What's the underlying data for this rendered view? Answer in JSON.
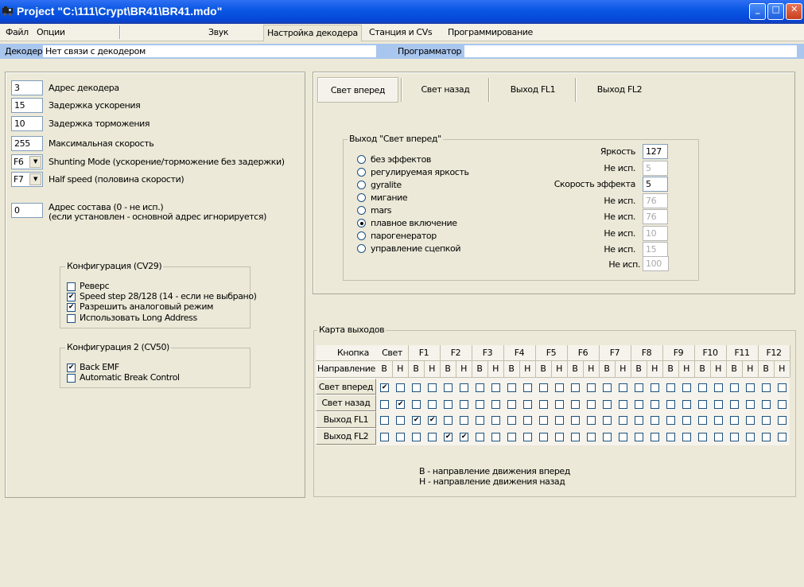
{
  "window": {
    "title": "Project  \"C:\\111\\Crypt\\BR41\\BR41.mdo\"",
    "minimize": "_",
    "maximize": "□",
    "close": "✕"
  },
  "menu": {
    "file": "Файл",
    "options": "Опции",
    "sound": "Звук",
    "decoder_settings": "Настройка декодера",
    "station_cvs": "Станция и CVs",
    "programming": "Программирование"
  },
  "status": {
    "decoder_label": "Декодер",
    "decoder_value": "Нет связи с декодером",
    "programmer_label": "Программатор",
    "programmer_value": ""
  },
  "left": {
    "address": {
      "value": "3",
      "label": "Адрес декодера"
    },
    "accel": {
      "value": "15",
      "label": "Задержка ускорения"
    },
    "decel": {
      "value": "10",
      "label": "Задержка торможения"
    },
    "maxspeed": {
      "value": "255",
      "label": "Максимальная скорость"
    },
    "shunting": {
      "value": "F6",
      "label": "Shunting Mode (ускорение/торможение без задержки)"
    },
    "halfspeed": {
      "value": "F7",
      "label": "Half speed (половина скорости)"
    },
    "consist": {
      "value": "0",
      "label1": "Адрес состава  (0 - не исп.)",
      "label2": "(если установлен - основной адрес игнорируется)"
    },
    "cv29": {
      "title": "Конфигурация (CV29)",
      "items": [
        {
          "label": "Реверс",
          "checked": false
        },
        {
          "label": "Speed step 28/128 (14 - если не выбрано)",
          "checked": true
        },
        {
          "label": "Разрешить аналоговый режим",
          "checked": true
        },
        {
          "label": "Использовать Long Address",
          "checked": false
        }
      ]
    },
    "cv50": {
      "title": "Конфигурация 2 (CV50)",
      "items": [
        {
          "label": "Back EMF",
          "checked": true
        },
        {
          "label": "Automatic Break Control",
          "checked": false
        }
      ]
    }
  },
  "tabs": [
    "Свет вперед",
    "Свет назад",
    "Выход FL1",
    "Выход FL2"
  ],
  "output": {
    "title": "Выход \"Свет вперед\"",
    "effects": [
      "без эффектов",
      "регулируемая яркость",
      "gyralite",
      "мигание",
      "mars",
      "плавное включение",
      "парогенератор",
      "управление сцепкой"
    ],
    "selected_effect": "плавное включение",
    "params": [
      {
        "label": "Яркость",
        "value": "127",
        "enabled": true
      },
      {
        "label": "Не исп.",
        "value": "5",
        "enabled": false
      },
      {
        "label": "Скорость эффекта",
        "value": "5",
        "enabled": true
      },
      {
        "label": "Не исп.",
        "value": "76",
        "enabled": false
      },
      {
        "label": "Не исп.",
        "value": "76",
        "enabled": false
      },
      {
        "label": "Не исп.",
        "value": "10",
        "enabled": false
      },
      {
        "label": "Не исп.",
        "value": "15",
        "enabled": false
      },
      {
        "label": "Не исп.",
        "value": "100",
        "enabled": false
      }
    ]
  },
  "map": {
    "title": "Карта выходов",
    "button_label": "Кнопка",
    "direction_label": "Направление",
    "fwd": "В",
    "rev": "Н",
    "buttons": [
      "Свет",
      "F1",
      "F2",
      "F3",
      "F4",
      "F5",
      "F6",
      "F7",
      "F8",
      "F9",
      "F10",
      "F11",
      "F12"
    ],
    "rows": [
      {
        "label": "Свет вперед",
        "checked": [
          0
        ]
      },
      {
        "label": "Свет назад",
        "checked": [
          1
        ]
      },
      {
        "label": "Выход FL1",
        "checked": [
          2,
          3
        ]
      },
      {
        "label": "Выход FL2",
        "checked": [
          4,
          5
        ]
      }
    ],
    "legend1": "В - направление движения вперед",
    "legend2": "Н - направление движения назад"
  }
}
